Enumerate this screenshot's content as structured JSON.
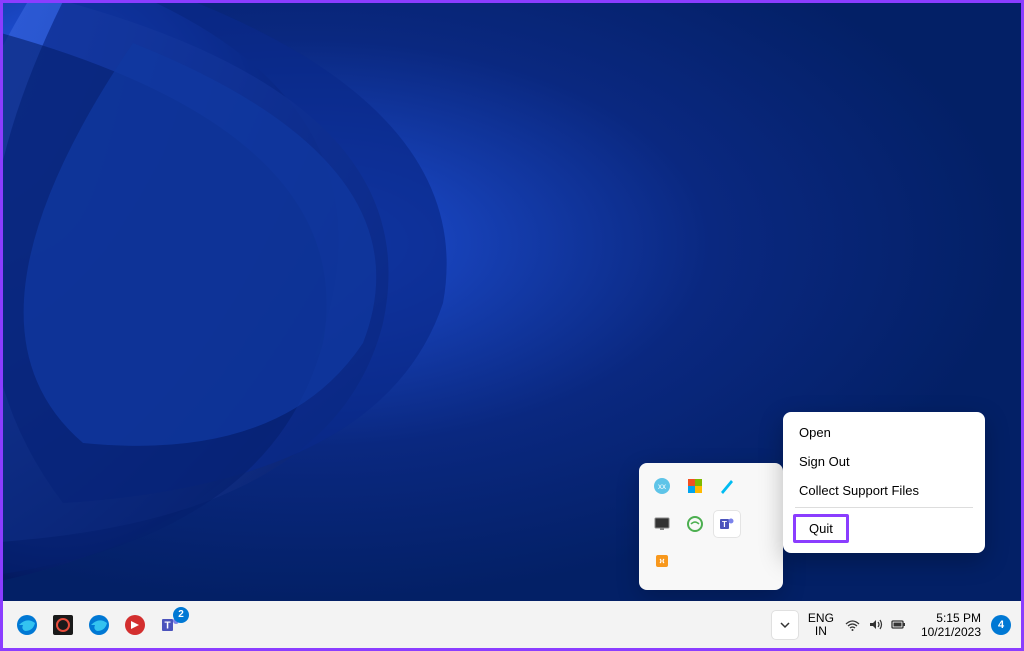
{
  "context_menu": {
    "items": [
      "Open",
      "Sign Out",
      "Collect Support Files"
    ],
    "highlighted": "Quit"
  },
  "taskbar": {
    "language_line1": "ENG",
    "language_line2": "IN",
    "time": "5:15 PM",
    "date": "10/21/2023",
    "teams_badge": "2",
    "notification_count": "4"
  },
  "tray_icons": [
    "app1-icon",
    "security-icon",
    "pen-icon",
    "",
    "display-icon",
    "browser-icon",
    "teams-icon",
    "",
    "java-icon",
    "",
    "",
    ""
  ]
}
